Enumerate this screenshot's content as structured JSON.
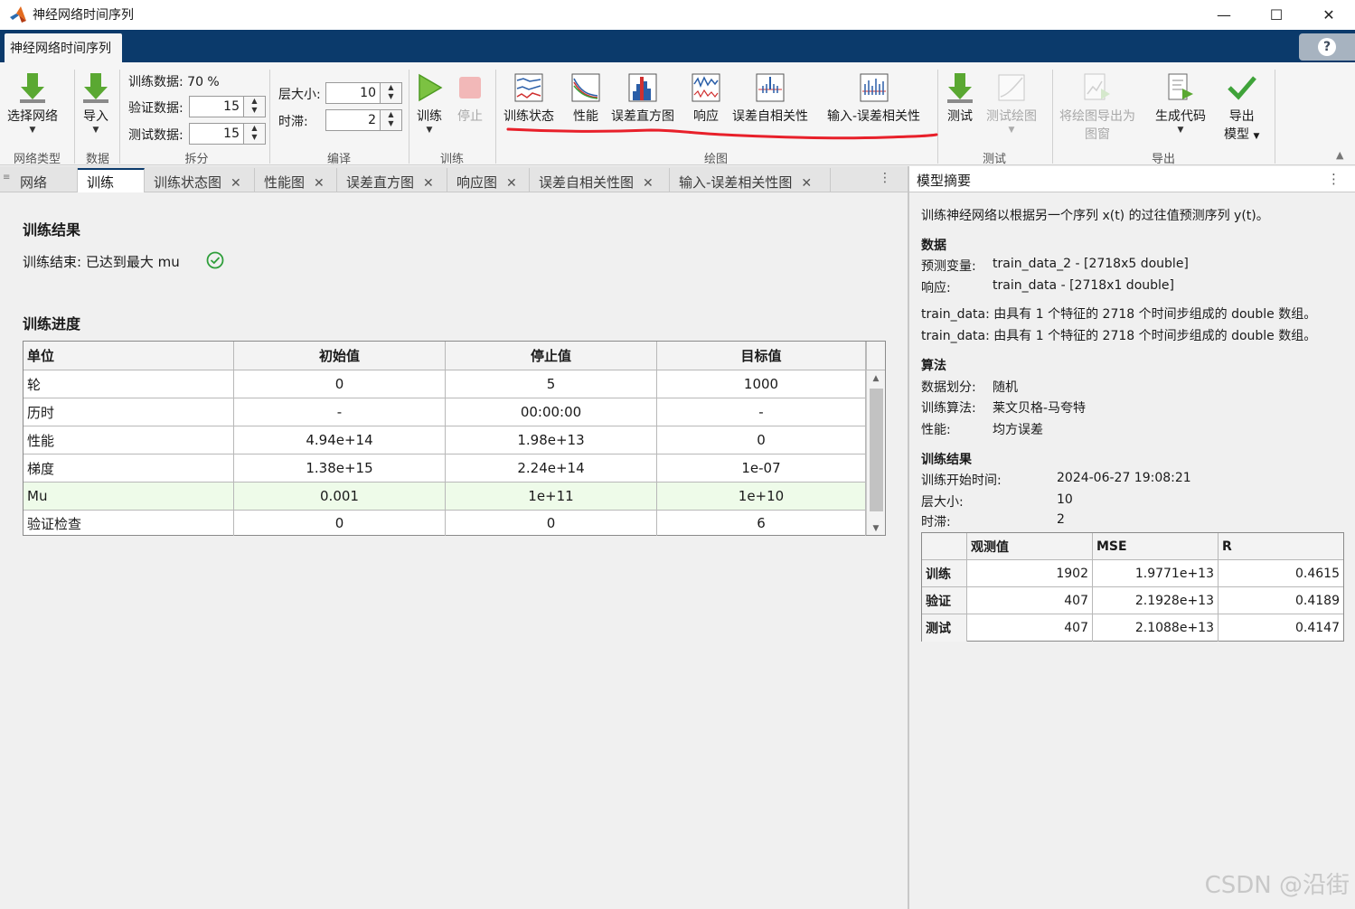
{
  "window": {
    "title": "神经网络时间序列",
    "minimize": "—",
    "maximize": "☐",
    "close": "✕"
  },
  "ribbon": {
    "tab": "神经网络时间序列",
    "help": "?",
    "buttons": {
      "select_network": "选择网络",
      "import": "导入",
      "train": "训练",
      "stop": "停止",
      "training_state": "训练状态",
      "performance": "性能",
      "error_histogram": "误差直方图",
      "response": "响应",
      "error_autocorrelation": "误差自相关性",
      "input_error_correlation": "输入-误差相关性",
      "test": "测试",
      "test_plot": "测试绘图",
      "export_plot_line1": "将绘图导出为",
      "export_plot_line2": "图窗",
      "generate_code": "生成代码",
      "export_model_line1": "导出",
      "export_model_line2": "模型"
    },
    "split": {
      "train_label": "训练数据: 70 %",
      "validation_label": "验证数据:",
      "validation_value": "15",
      "test_label": "测试数据:",
      "test_value": "15"
    },
    "compile": {
      "layer_label": "层大小:",
      "layer_value": "10",
      "delay_label": "时滞:",
      "delay_value": "2"
    },
    "groups": {
      "network_type": "网络类型",
      "data": "数据",
      "split": "拆分",
      "compile": "编译",
      "train": "训练",
      "plots": "绘图",
      "test": "测试",
      "export": "导出"
    },
    "colors": {
      "ribbon_bar": "#0b3a6b",
      "annotation": "#e8202a"
    }
  },
  "doc_tabs": [
    "网络",
    "训练",
    "训练状态图",
    "性能图",
    "误差直方图",
    "响应图",
    "误差自相关性图",
    "输入-误差相关性图"
  ],
  "main": {
    "results_title": "训练结果",
    "status": "训练结束: 已达到最大 mu",
    "progress_title": "训练进度",
    "table": {
      "headers": [
        "单位",
        "初始值",
        "停止值",
        "目标值"
      ],
      "rows": [
        [
          "轮",
          "0",
          "5",
          "1000"
        ],
        [
          "历时",
          "-",
          "00:00:00",
          "-"
        ],
        [
          "性能",
          "4.94e+14",
          "1.98e+13",
          "0"
        ],
        [
          "梯度",
          "1.38e+15",
          "2.24e+14",
          "1e-07"
        ],
        [
          "Mu",
          "0.001",
          "1e+11",
          "1e+10"
        ],
        [
          "验证检查",
          "0",
          "0",
          "6"
        ]
      ]
    }
  },
  "summary": {
    "title": "模型摘要",
    "intro": "训练神经网络以根据另一个序列 x(t) 的过往值预测序列 y(t)。",
    "data_heading": "数据",
    "predictor_label": "预测变量:",
    "predictor_value": "train_data_2 - [2718x5 double]",
    "response_label": "响应:",
    "response_value": "train_data - [2718x1 double]",
    "note1": "train_data: 由具有 1 个特征的 2718 个时间步组成的 double 数组。",
    "note2": "train_data: 由具有 1 个特征的 2718 个时间步组成的 double 数组。",
    "algo_heading": "算法",
    "division_label": "数据划分:",
    "division_value": "随机",
    "algorithm_label": "训练算法:",
    "algorithm_value": "莱文贝格-马夸特",
    "perf_label": "性能:",
    "perf_value": "均方误差",
    "results_heading": "训练结果",
    "start_label": "训练开始时间:",
    "start_value": "2024-06-27 19:08:21",
    "layer_label": "层大小:",
    "layer_value": "10",
    "delay_label": "时滞:",
    "delay_value": "2",
    "table": {
      "headers": [
        "",
        "观测值",
        "MSE",
        "R"
      ],
      "rows": [
        [
          "训练",
          "1902",
          "1.9771e+13",
          "0.4615"
        ],
        [
          "验证",
          "407",
          "2.1928e+13",
          "0.4189"
        ],
        [
          "测试",
          "407",
          "2.1088e+13",
          "0.4147"
        ]
      ]
    }
  },
  "watermark": "CSDN @沿街"
}
